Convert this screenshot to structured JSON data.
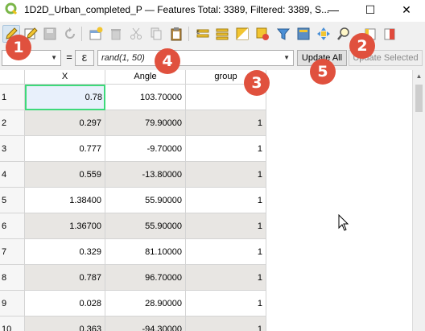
{
  "window": {
    "title": "1D2D_Urban_completed_P — Features Total: 3389, Filtered: 3389, S...",
    "minimize": "—",
    "maximize": "☐",
    "close": "✕"
  },
  "toolbar": {
    "icons": [
      "pencil-icon",
      "edit-multi-icon",
      "save-icon",
      "reload-icon",
      "add-feature-icon",
      "delete-icon",
      "cut-icon",
      "copy-icon",
      "paste-icon",
      "select-expression-icon",
      "select-all-icon",
      "invert-selection-icon",
      "deselect-icon",
      "filter-icon",
      "move-top-icon",
      "pan-icon",
      "zoom-icon",
      "new-field-icon",
      "delete-field-icon",
      "conditional-format-icon"
    ],
    "overflow": "»"
  },
  "expression_bar": {
    "field_combo_value": "",
    "equals": "=",
    "epsilon": "ε",
    "expression": "rand(1, 50)",
    "update_all": "Update All",
    "update_selected": "Update Selected"
  },
  "table": {
    "columns": [
      "X",
      "Angle",
      "group"
    ],
    "rows": [
      {
        "n": "1",
        "x": "0.78",
        "angle": "103.70000",
        "group": ""
      },
      {
        "n": "2",
        "x": "0.297",
        "angle": "79.90000",
        "group": "1"
      },
      {
        "n": "3",
        "x": "0.777",
        "angle": "-9.70000",
        "group": "1"
      },
      {
        "n": "4",
        "x": "0.559",
        "angle": "-13.80000",
        "group": "1"
      },
      {
        "n": "5",
        "x": "1.38400",
        "angle": "55.90000",
        "group": "1"
      },
      {
        "n": "6",
        "x": "1.36700",
        "angle": "55.90000",
        "group": "1"
      },
      {
        "n": "7",
        "x": "0.329",
        "angle": "81.10000",
        "group": "1"
      },
      {
        "n": "8",
        "x": "0.787",
        "angle": "96.70000",
        "group": "1"
      },
      {
        "n": "9",
        "x": "0.028",
        "angle": "28.90000",
        "group": "1"
      },
      {
        "n": "10",
        "x": "0.363",
        "angle": "-94.30000",
        "group": "1"
      }
    ]
  },
  "callouts": [
    "1",
    "2",
    "3",
    "4",
    "5"
  ],
  "colors": {
    "callout": "#e0513e",
    "selected_border": "#3ed97a",
    "alt_row": "#e8e6e3"
  }
}
